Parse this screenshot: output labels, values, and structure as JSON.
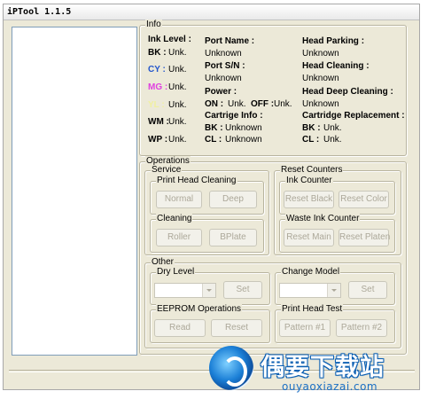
{
  "window": {
    "title": "iPTool 1.1.5"
  },
  "info": {
    "group_label": "Info",
    "ink_level": {
      "label": "Ink Level :",
      "rows": [
        {
          "name": "BK :",
          "value": "Unk.",
          "color": "#000000"
        },
        {
          "name": "CY :",
          "value": "Unk.",
          "color": "#2255cc"
        },
        {
          "name": "MG :",
          "value": "Unk.",
          "color": "#e040e0"
        },
        {
          "name": "YL :",
          "value": "Unk.",
          "color": "#f0f0a0"
        },
        {
          "name": "WM :",
          "value": "Unk.",
          "color": "#000000"
        },
        {
          "name": "WP :",
          "value": "Unk.",
          "color": "#000000"
        }
      ]
    },
    "port_name": {
      "label": "Port Name :",
      "value": "Unknown"
    },
    "port_sn": {
      "label": "Port S/N :",
      "value": "Unknown"
    },
    "power": {
      "label": "Power :",
      "on_label": "ON :",
      "on_value": "Unk.",
      "off_label": "OFF :",
      "off_value": "Unk."
    },
    "cartrige_info": {
      "label": "Cartrige Info :",
      "bk_label": "BK :",
      "bk_value": "Unknown",
      "cl_label": "CL :",
      "cl_value": "Unknown"
    },
    "head_parking": {
      "label": "Head Parking :",
      "value": "Unknown"
    },
    "head_cleaning": {
      "label": "Head Cleaning :",
      "value": "Unknown"
    },
    "head_deep_cleaning": {
      "label": "Head Deep Cleaning :",
      "value": "Unknown"
    },
    "cartridge_replacement": {
      "label": "Cartridge Replacement :",
      "bk_label": "BK :",
      "bk_value": "Unk.",
      "cl_label": "CL :",
      "cl_value": "Unk."
    }
  },
  "operations": {
    "group_label": "Operations",
    "service": {
      "group_label": "Service",
      "print_head_cleaning": {
        "group_label": "Print Head Cleaning",
        "normal": "Normal",
        "deep": "Deep"
      },
      "cleaning": {
        "group_label": "Cleaning",
        "roller": "Roller",
        "bplate": "BPlate"
      }
    },
    "reset_counters": {
      "group_label": "Reset Counters",
      "ink_counter": {
        "group_label": "Ink Counter",
        "reset_black": "Reset Black",
        "reset_color": "Reset Color"
      },
      "waste_ink_counter": {
        "group_label": "Waste Ink Counter",
        "reset_main": "Reset Main",
        "reset_platen": "Reset Platen"
      }
    },
    "other": {
      "group_label": "Other",
      "dry_level": {
        "group_label": "Dry Level",
        "set": "Set",
        "value": ""
      },
      "change_model": {
        "group_label": "Change Model",
        "set": "Set",
        "value": ""
      },
      "eeprom": {
        "group_label": "EEPROM Operations",
        "read": "Read",
        "reset": "Reset"
      },
      "print_head_test": {
        "group_label": "Print Head Test",
        "pattern1": "Pattern #1",
        "pattern2": "Pattern #2"
      }
    }
  },
  "watermark": {
    "cn": "偶要下载站",
    "en": "ouyaoxiazai.com"
  }
}
